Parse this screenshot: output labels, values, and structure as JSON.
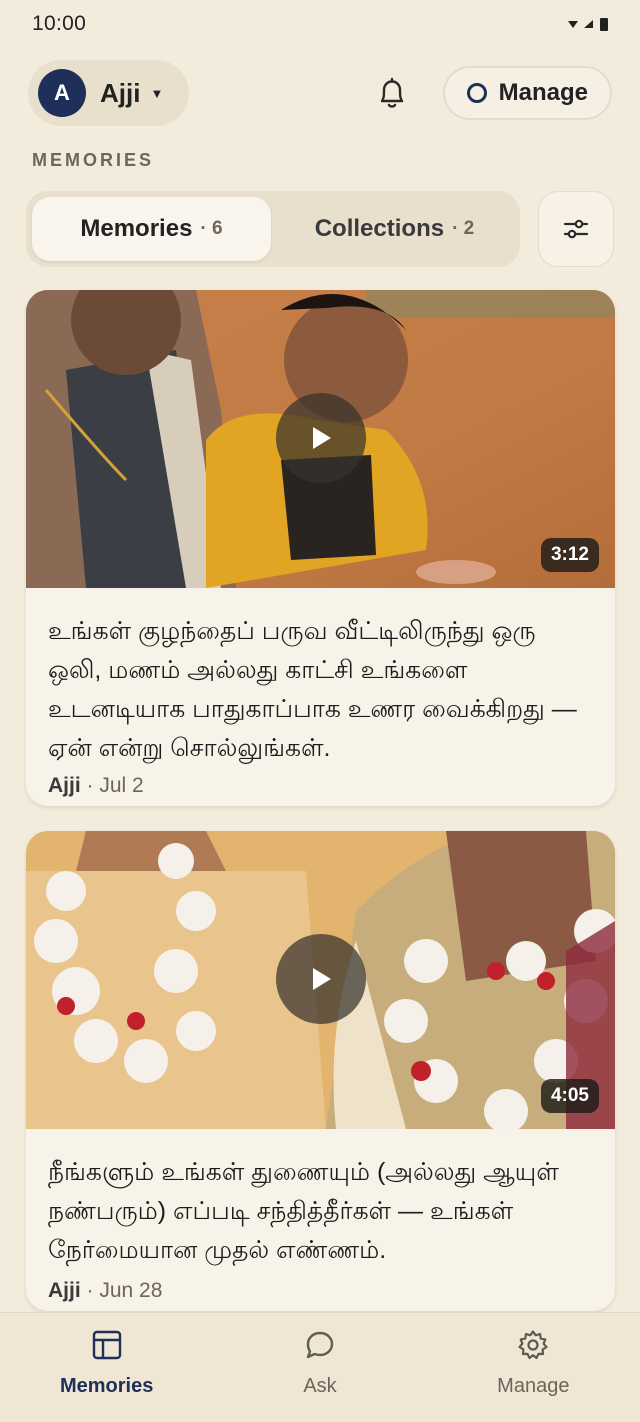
{
  "status": {
    "time": "10:00"
  },
  "header": {
    "avatar_initial": "A",
    "profile_name": "Ajji",
    "manage_label": "Manage"
  },
  "section_label": "MEMORIES",
  "tabs": [
    {
      "label": "Memories",
      "count": "· 6",
      "active": true
    },
    {
      "label": "Collections",
      "count": "· 2",
      "active": false
    }
  ],
  "cards": [
    {
      "duration": "3:12",
      "prompt": "உங்கள் குழந்தைப் பருவ வீட்டிலிருந்து ஒரு ஒலி, மணம் அல்லது காட்சி உங்களை உடனடியாக பாதுகாப்பாக உணர வைக்கிறது — ஏன் என்று சொல்லுங்கள்.",
      "author": "Ajji",
      "date": "· Jul 2"
    },
    {
      "duration": "4:05",
      "prompt": "நீங்களும் உங்கள் துணையும் (அல்லது ஆயுள் நண்பரும்) எப்படி சந்தித்தீர்கள் — உங்கள் நேர்மையான முதல் எண்ணம்.",
      "author": "Ajji",
      "date": "· Jun 28"
    }
  ],
  "nav": {
    "memories": "Memories",
    "ask": "Ask",
    "manage": "Manage"
  },
  "colors": {
    "background": "#f3ecdd",
    "accent": "#1e2f5a",
    "card": "#f8f3e8"
  }
}
